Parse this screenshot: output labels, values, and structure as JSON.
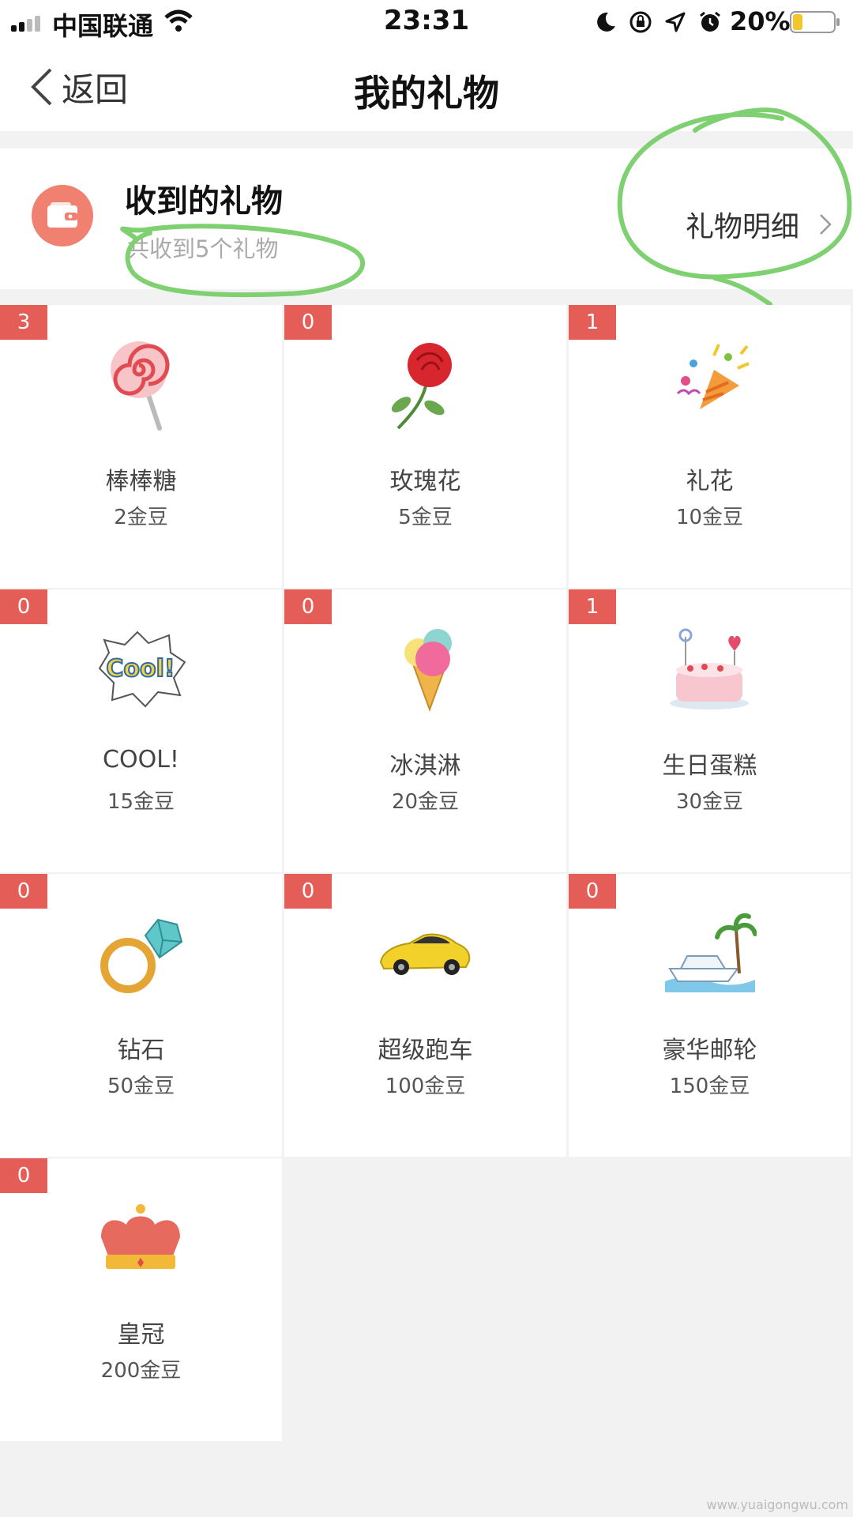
{
  "status_bar": {
    "carrier": "中国联通",
    "time": "23:31",
    "battery": "20%",
    "icons": [
      "signal-icon",
      "wifi-icon",
      "moon-icon",
      "rotation-lock-icon",
      "location-icon",
      "alarm-icon",
      "battery-icon"
    ]
  },
  "nav": {
    "back_label": "返回",
    "title": "我的礼物"
  },
  "summary": {
    "title": "收到的礼物",
    "subtitle": "共收到5个礼物",
    "detail_label": "礼物明细",
    "icon": "wallet-icon"
  },
  "gifts": [
    {
      "count": "3",
      "name": "棒棒糖",
      "price": "2金豆",
      "icon": "lollipop-icon"
    },
    {
      "count": "0",
      "name": "玫瑰花",
      "price": "5金豆",
      "icon": "rose-icon"
    },
    {
      "count": "1",
      "name": "礼花",
      "price": "10金豆",
      "icon": "party-popper-icon"
    },
    {
      "count": "0",
      "name": "COOL!",
      "price": "15金豆",
      "icon": "cool-sticker-icon"
    },
    {
      "count": "0",
      "name": "冰淇淋",
      "price": "20金豆",
      "icon": "ice-cream-icon"
    },
    {
      "count": "1",
      "name": "生日蛋糕",
      "price": "30金豆",
      "icon": "birthday-cake-icon"
    },
    {
      "count": "0",
      "name": "钻石",
      "price": "50金豆",
      "icon": "diamond-ring-icon"
    },
    {
      "count": "0",
      "name": "超级跑车",
      "price": "100金豆",
      "icon": "sports-car-icon"
    },
    {
      "count": "0",
      "name": "豪华邮轮",
      "price": "150金豆",
      "icon": "yacht-icon"
    },
    {
      "count": "0",
      "name": "皇冠",
      "price": "200金豆",
      "icon": "crown-icon"
    }
  ],
  "watermark": "www.yuaigongwu.com",
  "colors": {
    "badge": "#e45d57",
    "wallet": "#f08070",
    "annotation": "#7ed070"
  }
}
